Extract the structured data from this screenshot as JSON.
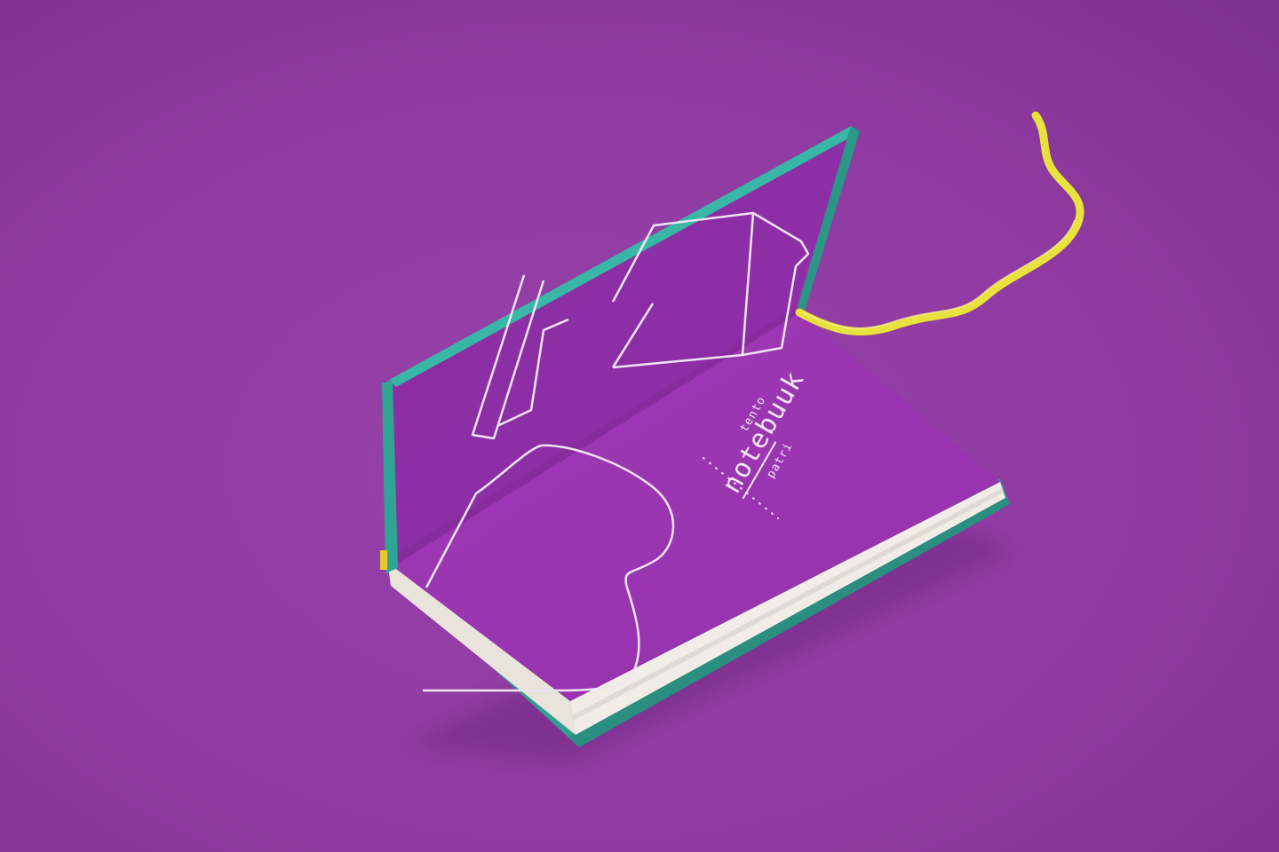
{
  "photo": {
    "subject": "open notebook with folded cover on purple backdrop",
    "brand": {
      "prefix": "tento",
      "wordmark": "notebuuk",
      "suffix": "patri"
    },
    "colors": {
      "background": "#8e3aa0",
      "background_shadow": "#7c2f8e",
      "page": "#9a36b0",
      "inner_cover": "#8a2ea2",
      "cloth": "#38b7a6",
      "cloth_dark": "#2b9787",
      "paper_edge": "#f1ede6",
      "ribbon": "#e9e13c",
      "line_art": "#efe4f2"
    }
  }
}
